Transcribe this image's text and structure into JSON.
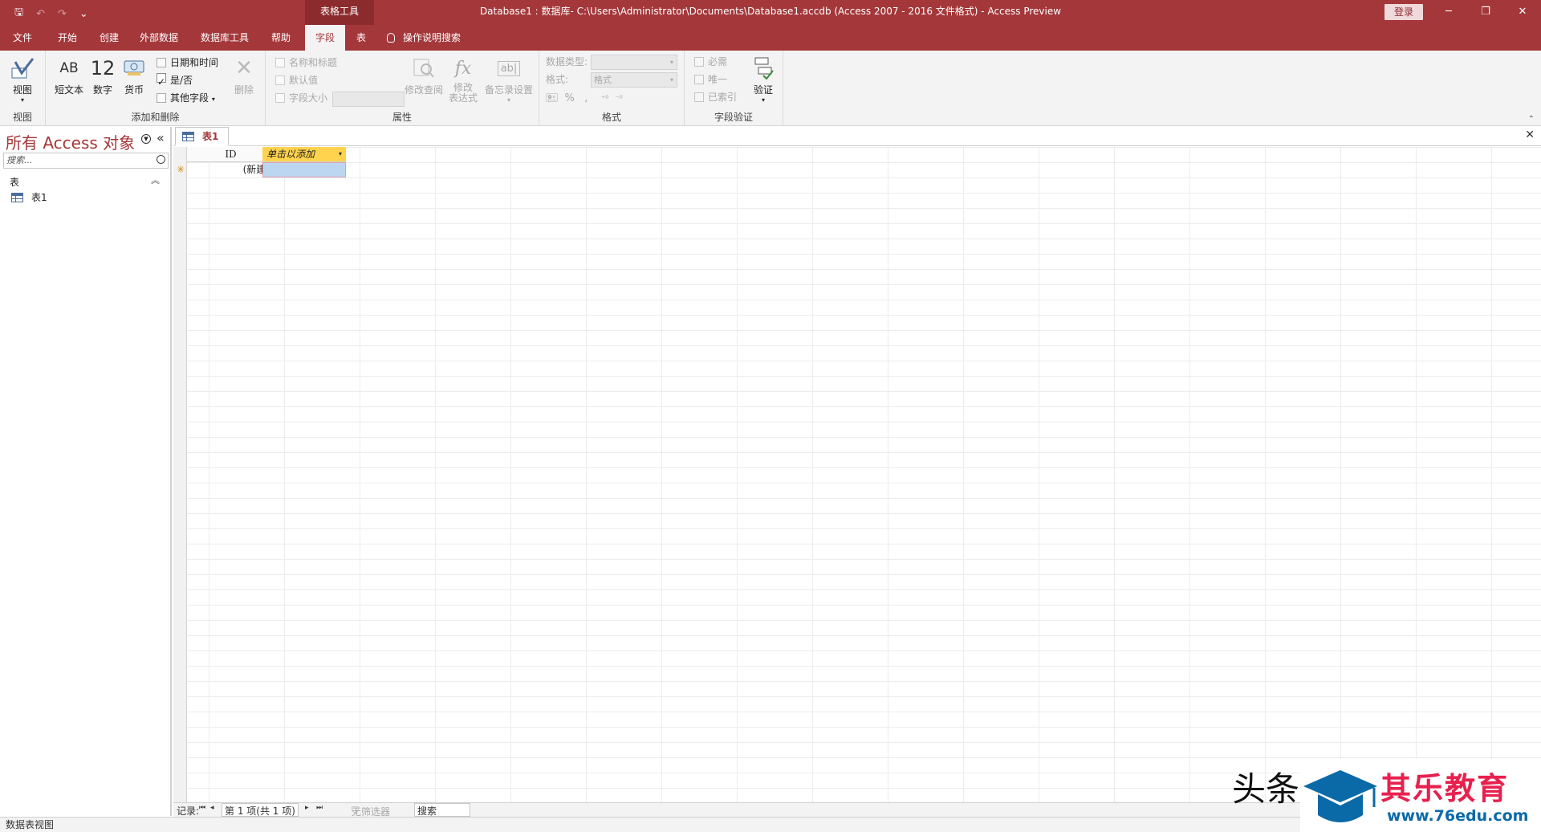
{
  "titlebar": {
    "save_icon": "save-icon",
    "undo_icon": "undo-icon",
    "redo_icon": "redo-icon",
    "customize_icon": "customize-qat-icon",
    "context_group": "表格工具",
    "document_title": "Database1 : 数据库- C:\\Users\\Administrator\\Documents\\Database1.accdb (Access 2007 - 2016 文件格式)  -  Access Preview",
    "signin": "登录",
    "minimize": "─",
    "restore": "❐",
    "close": "✕"
  },
  "ribbon_tabs": [
    {
      "label": "文件"
    },
    {
      "label": "开始"
    },
    {
      "label": "创建"
    },
    {
      "label": "外部数据"
    },
    {
      "label": "数据库工具"
    },
    {
      "label": "帮助"
    },
    {
      "label": "字段"
    },
    {
      "label": "表"
    }
  ],
  "tell_me": "操作说明搜索",
  "ribbon": {
    "view": {
      "label": "视图",
      "group": "视图"
    },
    "add_delete": {
      "group": "添加和删除",
      "short_text_icon": "AB",
      "short_text": "短文本",
      "number_icon": "12",
      "number": "数字",
      "currency": "货币",
      "datetime": "日期和时间",
      "yesno": "是/否",
      "more_fields": "其他字段",
      "delete": "删除"
    },
    "properties": {
      "group": "属性",
      "name_caption": "名称和标题",
      "default_value": "默认值",
      "field_size": "字段大小",
      "modify_lookups": "修改查阅",
      "modify_expression_l1": "修改",
      "modify_expression_l2": "表达式",
      "memo_settings": "备忘录设置",
      "fx_icon": "fx",
      "ab_icon": "ab|"
    },
    "formatting": {
      "group": "格式",
      "data_type_label": "数据类型:",
      "format_label": "格式:",
      "format_value": "格式",
      "percent": "%",
      "comma": ","
    },
    "validation": {
      "group": "字段验证",
      "required": "必需",
      "unique": "唯一",
      "indexed": "已索引",
      "validate": "验证"
    }
  },
  "nav": {
    "title": "所有 Access 对象",
    "search_placeholder": "搜索...",
    "section": "表",
    "item": "表1"
  },
  "document": {
    "tab": "表1",
    "close": "✕",
    "columns": [
      {
        "label": "ID"
      },
      {
        "label": "单击以添加"
      }
    ],
    "new_row_marker": "✳",
    "new_row_id": "(新建)"
  },
  "record_nav": {
    "label": "记录:",
    "first": "⏮",
    "prev": "◂",
    "position": "第 1 项(共 1 项)",
    "next": "▸",
    "last": "⏭",
    "filter": "无筛选器",
    "search": "搜索"
  },
  "status": "数据表视图",
  "watermark": {
    "head": "头条",
    "brand": "其乐教育",
    "url": "www.76edu.com"
  },
  "colors": {
    "accent": "#a4373a",
    "header_highlight": "#ffd34d",
    "selection": "#bcd6f2",
    "brand_red": "#e8204e",
    "brand_blue": "#0a6aa8"
  }
}
